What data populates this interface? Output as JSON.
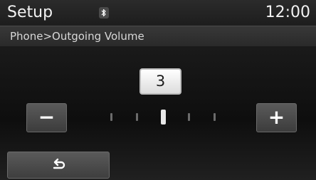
{
  "header": {
    "title": "Setup",
    "bluetooth_icon": "bluetooth-icon",
    "clock": "12:00"
  },
  "breadcrumb": "Phone>Outgoing Volume",
  "volume": {
    "value": "3",
    "level_index": 3,
    "tick_count": 5,
    "minus_label": "−",
    "plus_label": "+"
  },
  "footer": {
    "back_icon": "back-arrow-icon"
  }
}
